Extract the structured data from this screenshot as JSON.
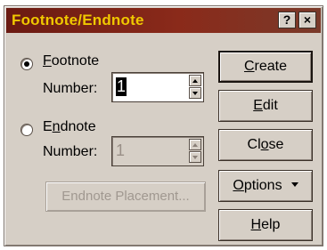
{
  "window": {
    "title": "Footnote/Endnote",
    "help_glyph": "?",
    "close_glyph": "×"
  },
  "footnote": {
    "label": "Footnote",
    "number_label": "Number:",
    "number_value": "1",
    "selected": true
  },
  "endnote": {
    "label": "Endnote",
    "number_label": "Number:",
    "number_value": "1",
    "selected": false
  },
  "placement_button": "Endnote Placement...",
  "buttons": {
    "create": "Create",
    "edit": "Edit",
    "close": "Close",
    "options": "Options",
    "help": "Help"
  },
  "colors": {
    "title_bar": "#7a2014",
    "title_text": "#f0c800",
    "face": "#d6cfc6"
  }
}
